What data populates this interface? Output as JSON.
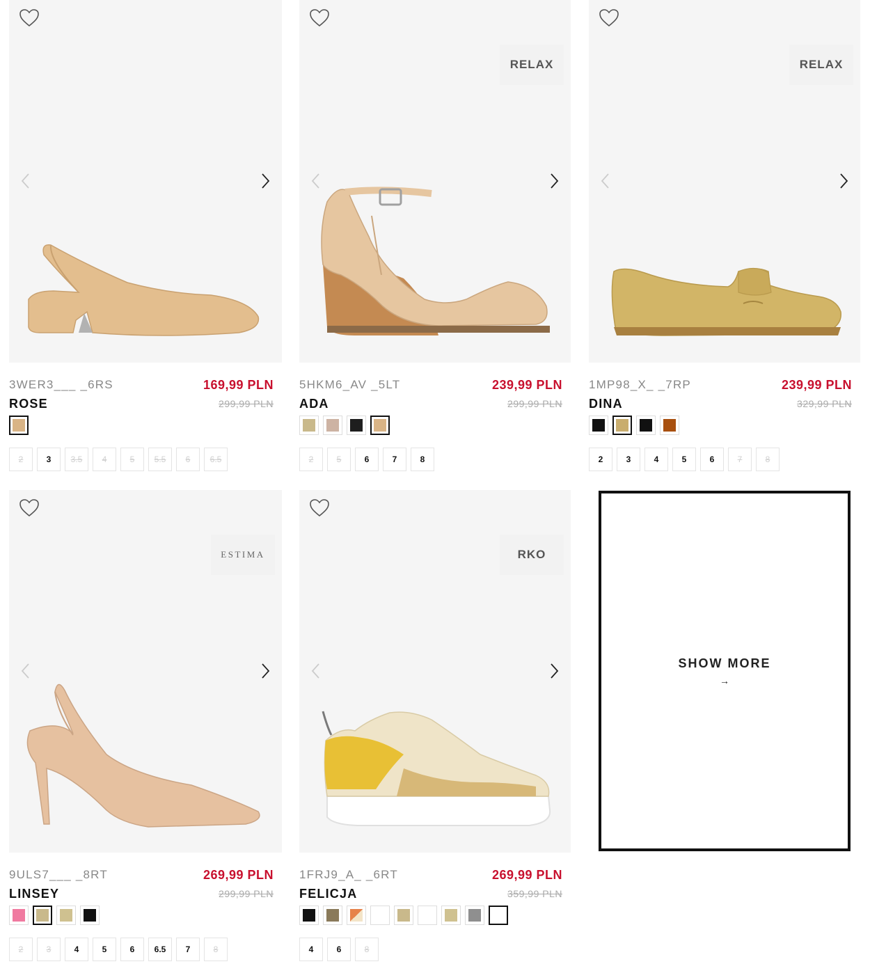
{
  "icons": {
    "wishlist": "heart-outline-icon",
    "prev": "chevron-left-icon",
    "next": "chevron-right-icon"
  },
  "colors": {
    "price_red": "#c8102e",
    "bg_image": "#f5f5f5"
  },
  "products": [
    {
      "sku": "3WER3___ _6RS",
      "name": "ROSE",
      "price": "169,99 PLN",
      "old_price": "299,99 PLN",
      "brand": "",
      "swatches": [
        {
          "color": "#d9b486",
          "selected": true
        }
      ],
      "sizes": [
        {
          "label": "2",
          "available": false
        },
        {
          "label": "3",
          "available": true
        },
        {
          "label": "3.5",
          "available": false
        },
        {
          "label": "4",
          "available": false
        },
        {
          "label": "5",
          "available": false
        },
        {
          "label": "5.5",
          "available": false
        },
        {
          "label": "6",
          "available": false
        },
        {
          "label": "6.5",
          "available": false
        }
      ]
    },
    {
      "sku": "5HKM6_AV _5LT",
      "name": "ADA",
      "price": "239,99 PLN",
      "old_price": "299,99 PLN",
      "brand": "RELAX",
      "swatches": [
        {
          "color": "#c9b98b",
          "selected": false
        },
        {
          "color": "#cdb3a3",
          "selected": false
        },
        {
          "color": "#1e1e1e",
          "selected": false
        },
        {
          "color": "#d9b486",
          "selected": true
        }
      ],
      "sizes": [
        {
          "label": "2",
          "available": false
        },
        {
          "label": "5",
          "available": false
        },
        {
          "label": "6",
          "available": true
        },
        {
          "label": "7",
          "available": true
        },
        {
          "label": "8",
          "available": true
        }
      ]
    },
    {
      "sku": "1MP98_X_ _7RP",
      "name": "DINA",
      "price": "239,99 PLN",
      "old_price": "329,99 PLN",
      "brand": "RELAX",
      "swatches": [
        {
          "color": "#111111",
          "selected": false
        },
        {
          "color": "#c9ad6e",
          "selected": true
        },
        {
          "color": "#111111",
          "selected": false
        },
        {
          "color": "#a8500f",
          "selected": false
        }
      ],
      "sizes": [
        {
          "label": "2",
          "available": true
        },
        {
          "label": "3",
          "available": true
        },
        {
          "label": "4",
          "available": true
        },
        {
          "label": "5",
          "available": true
        },
        {
          "label": "6",
          "available": true
        },
        {
          "label": "7",
          "available": false
        },
        {
          "label": "8",
          "available": false
        }
      ]
    },
    {
      "sku": "9ULS7___ _8RT",
      "name": "LINSEY",
      "price": "269,99 PLN",
      "old_price": "299,99 PLN",
      "brand": "ESTIMA",
      "swatches": [
        {
          "color": "#f07aa0",
          "selected": false
        },
        {
          "color": "#c9b98b",
          "selected": true
        },
        {
          "color": "#cfc190",
          "selected": false
        },
        {
          "color": "#111111",
          "selected": false
        }
      ],
      "sizes": [
        {
          "label": "2",
          "available": false
        },
        {
          "label": "3",
          "available": false
        },
        {
          "label": "4",
          "available": true
        },
        {
          "label": "5",
          "available": true
        },
        {
          "label": "6",
          "available": true
        },
        {
          "label": "6.5",
          "available": true
        },
        {
          "label": "7",
          "available": true
        },
        {
          "label": "8",
          "available": false
        }
      ]
    },
    {
      "sku": "1FRJ9_A_ _6RT",
      "name": "FELICJA",
      "price": "269,99 PLN",
      "old_price": "359,99 PLN",
      "brand": "RKO",
      "swatches": [
        {
          "color": "#111111",
          "selected": false
        },
        {
          "color": "#8a7a5a",
          "selected": false
        },
        {
          "color": "#e6824a",
          "selected": false
        },
        {
          "color": "#ffffff",
          "selected": false
        },
        {
          "color": "#c9b98b",
          "selected": false
        },
        {
          "color": "#ffffff",
          "selected": false
        },
        {
          "color": "#cfc190",
          "selected": false
        },
        {
          "color": "#8f8f8f",
          "selected": false
        },
        {
          "color": "#ffffff",
          "selected": true
        }
      ],
      "sizes": [
        {
          "label": "4",
          "available": true
        },
        {
          "label": "6",
          "available": true
        },
        {
          "label": "8",
          "available": false
        }
      ]
    }
  ],
  "show_more": {
    "label": "SHOW MORE",
    "arrow": "→"
  }
}
